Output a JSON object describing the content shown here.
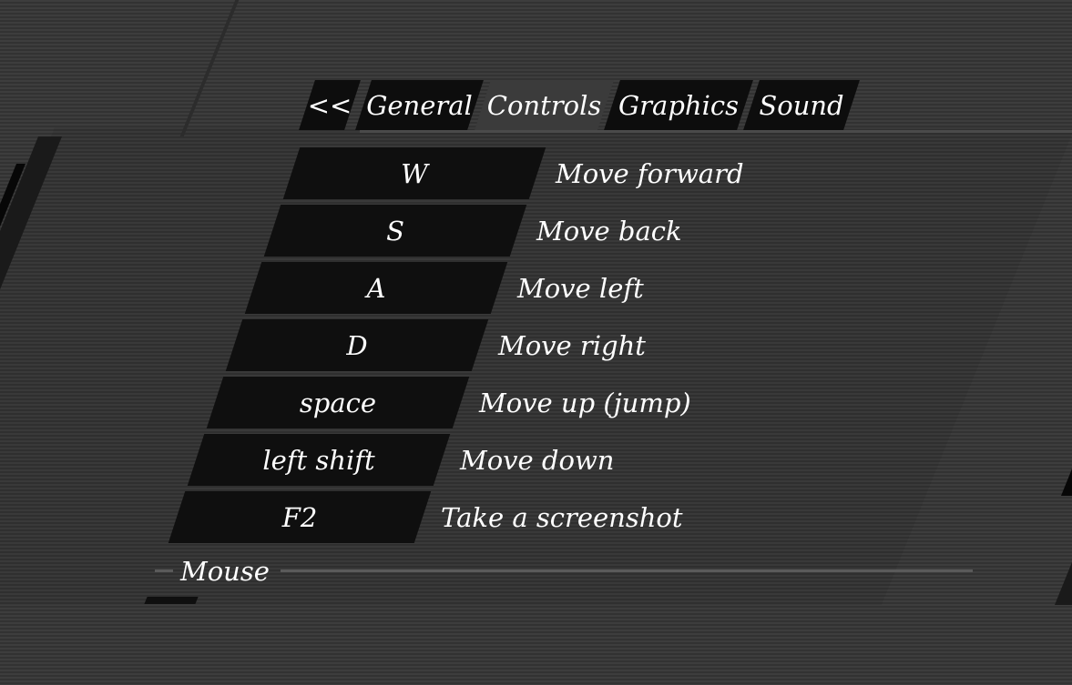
{
  "tabs": [
    {
      "label": "<<",
      "active": false
    },
    {
      "label": "General",
      "active": false
    },
    {
      "label": "Controls",
      "active": true
    },
    {
      "label": "Graphics",
      "active": false
    },
    {
      "label": "Sound",
      "active": false
    }
  ],
  "bindings": [
    {
      "key": "W",
      "action": "Move forward"
    },
    {
      "key": "S",
      "action": "Move back"
    },
    {
      "key": "A",
      "action": "Move left"
    },
    {
      "key": "D",
      "action": "Move right"
    },
    {
      "key": "space",
      "action": "Move up (jump)"
    },
    {
      "key": "left shift",
      "action": "Move down"
    },
    {
      "key": "F2",
      "action": "Take a screenshot"
    }
  ],
  "sections": {
    "mouse": "Mouse"
  },
  "colors": {
    "background": "#3a3a3a",
    "box": "#0f0f0f",
    "active_tab": "#3b3b3b",
    "text": "#ffffff"
  }
}
